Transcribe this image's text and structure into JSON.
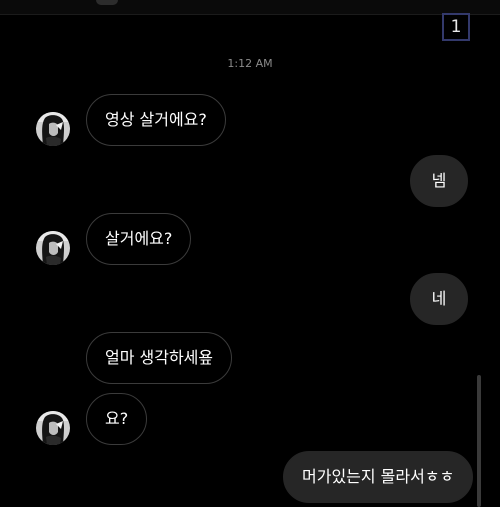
{
  "header": {
    "unread_count": "1"
  },
  "thread": {
    "timestamp": "1:12 AM",
    "messages": [
      {
        "id": "m1",
        "direction": "incoming",
        "text": "영상 살거에요?"
      },
      {
        "id": "m2",
        "direction": "outgoing",
        "text": "넴"
      },
      {
        "id": "m3",
        "direction": "incoming",
        "text": "살거에요?"
      },
      {
        "id": "m4",
        "direction": "outgoing",
        "text": "네"
      },
      {
        "id": "m5",
        "direction": "incoming",
        "text": "얼마 생각하세욮"
      },
      {
        "id": "m6",
        "direction": "incoming",
        "text": "요?"
      },
      {
        "id": "m7",
        "direction": "outgoing",
        "text": "머가있는지 몰라서ㅎㅎ"
      }
    ]
  },
  "colors": {
    "background": "#000000",
    "incoming_border": "#3b3b3b",
    "outgoing_fill": "#262626",
    "badge_border": "#33396b",
    "timestamp_text": "#8a8a8a"
  },
  "icons": {
    "avatar": "contact-avatar-photo"
  }
}
